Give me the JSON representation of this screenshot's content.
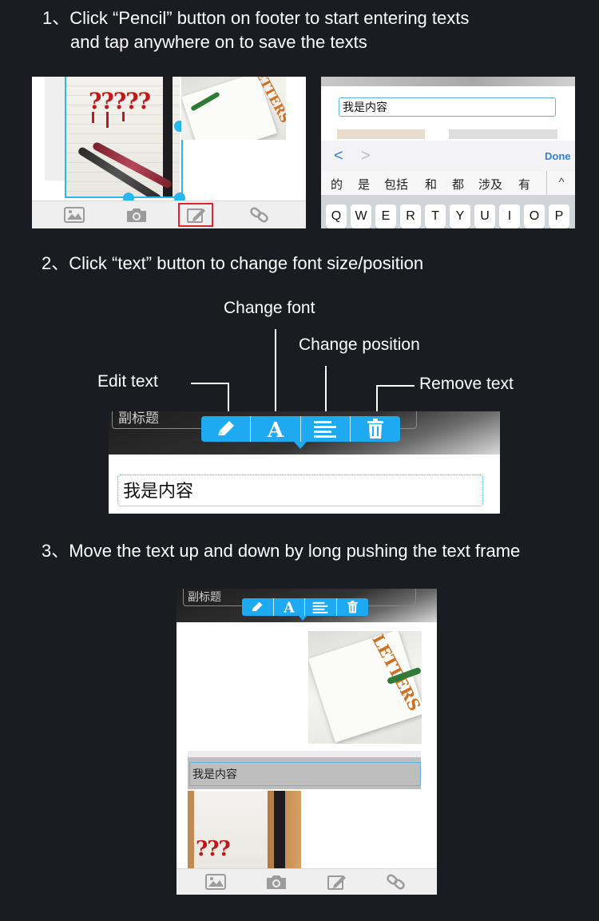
{
  "step1": {
    "line1": "1、Click “Pencil” button on footer to start entering texts",
    "line2": "and tap anywhere on to save the texts",
    "editor_input_text": "我是内容",
    "photo_word": "LETTERS",
    "keyboard": {
      "nav_back": "<",
      "nav_forward": ">",
      "done_label": "Done",
      "candidates": [
        "的",
        "是",
        "包括",
        "和",
        "都",
        "涉及",
        "有"
      ],
      "collapse": "^",
      "keys": [
        "Q",
        "W",
        "E",
        "R",
        "T",
        "Y",
        "U",
        "I",
        "O",
        "P"
      ]
    },
    "graffiti": "?????"
  },
  "step2": {
    "title": "2、Click “text” button to change font size/position",
    "callouts": {
      "change_font": "Change font",
      "change_position": "Change position",
      "edit_text": "Edit text",
      "remove_text": "Remove text"
    },
    "subtitle_cut": "副标题",
    "content_text": "我是内容"
  },
  "step3": {
    "title": "3、Move the text up and down by long pushing the text frame",
    "subtitle": "副标题",
    "content_text": "我是内容",
    "photo_word": "LETTERS",
    "graffiti": "???"
  },
  "colors": {
    "background": "#1b1c21",
    "accent_blue": "#1eaaf1",
    "highlight_red": "#e0262c"
  },
  "icons": {
    "footer": [
      "image-icon",
      "camera-icon",
      "pencil-icon",
      "link-icon"
    ],
    "toolbar": [
      "pencil-icon",
      "font-icon",
      "align-icon",
      "trash-icon"
    ]
  }
}
